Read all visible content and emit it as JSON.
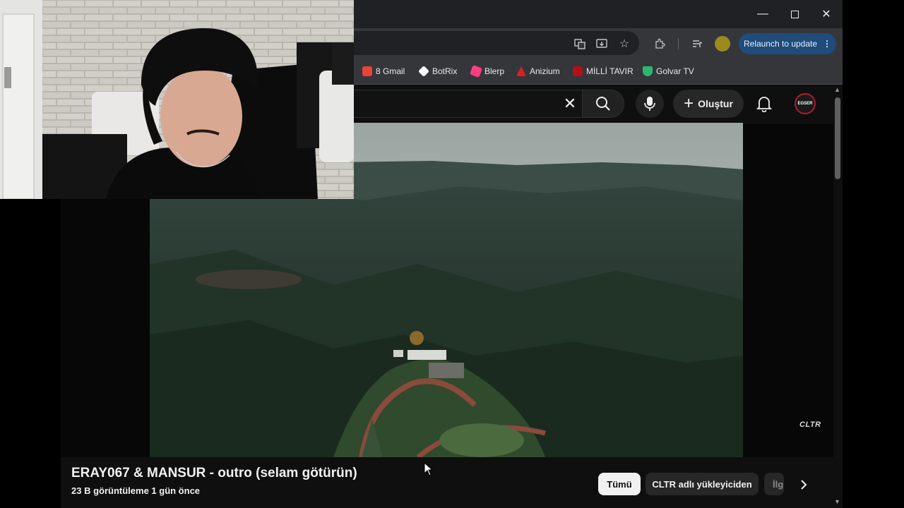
{
  "browser": {
    "relaunch_label": "Relaunch to update",
    "bookmarks": [
      {
        "label": "8 Gmail",
        "icon": "gmail-icon",
        "color": "#ea4335"
      },
      {
        "label": "BotRix",
        "icon": "botrix-icon",
        "color": "#ffffff"
      },
      {
        "label": "Blerp",
        "icon": "blerp-icon",
        "color": "#ff3d7f"
      },
      {
        "label": "Anizium",
        "icon": "anizium-icon",
        "color": "#e01e1e"
      },
      {
        "label": "MİLLİ TAVIR",
        "icon": "milli-tavir-icon",
        "color": "#b3101a"
      },
      {
        "label": "Golvar TV",
        "icon": "golvar-icon",
        "color": "#2bb673"
      }
    ]
  },
  "youtube": {
    "create_label": "Oluştur",
    "avatar_text": "EGSER",
    "video": {
      "watermark": "CLTR",
      "title": "ERAY067 & MANSUR - outro (selam götürün)",
      "meta": "23 B görüntüleme  1 gün önce"
    },
    "chips": [
      "Tümü",
      "CLTR adlı yükleyiciden",
      "İlg"
    ]
  },
  "colors": {
    "accent": "#1f4c7a",
    "background": "#0f0f0f",
    "chip_active": "#f1f1f1"
  }
}
